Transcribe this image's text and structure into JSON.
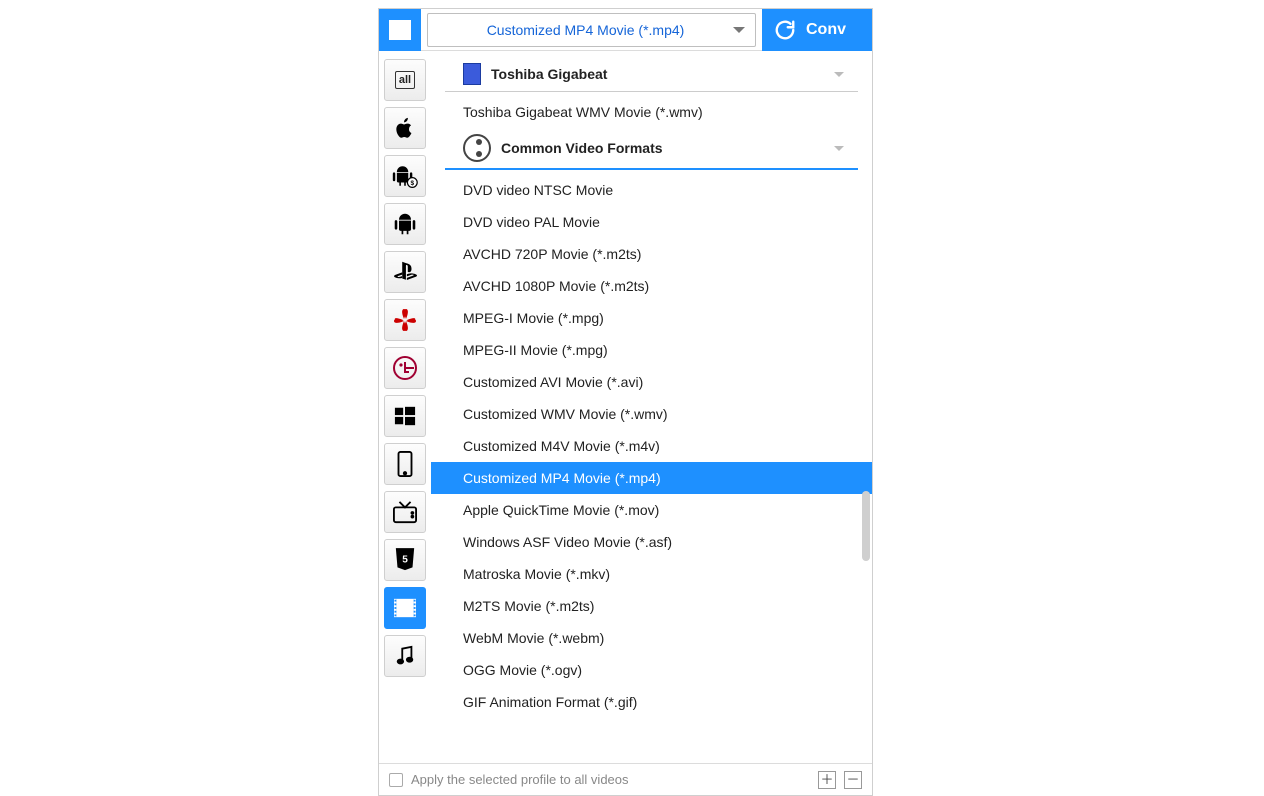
{
  "topbar": {
    "selected_format": "Customized MP4 Movie (*.mp4)",
    "convert_label": "Conv"
  },
  "sidebar": {
    "items": [
      {
        "name": "all",
        "label": "All"
      },
      {
        "name": "apple",
        "label": "Apple"
      },
      {
        "name": "android-paid",
        "label": "Android Paid"
      },
      {
        "name": "android",
        "label": "Android"
      },
      {
        "name": "playstation",
        "label": "PlayStation"
      },
      {
        "name": "huawei",
        "label": "Huawei"
      },
      {
        "name": "lg",
        "label": "LG"
      },
      {
        "name": "windows",
        "label": "Windows"
      },
      {
        "name": "phone",
        "label": "Phone"
      },
      {
        "name": "tv",
        "label": "TV"
      },
      {
        "name": "html5",
        "label": "HTML5"
      },
      {
        "name": "video",
        "label": "Video",
        "active": true
      },
      {
        "name": "audio",
        "label": "Audio"
      }
    ]
  },
  "groups": [
    {
      "title": "Toshiba Gigabeat",
      "icon": "toshiba",
      "items": [
        "Toshiba Gigabeat WMV Movie (*.wmv)"
      ]
    },
    {
      "title": "Common Video Formats",
      "icon": "reel",
      "items": [
        "DVD video NTSC Movie",
        "DVD video PAL Movie",
        "AVCHD 720P Movie (*.m2ts)",
        "AVCHD 1080P Movie (*.m2ts)",
        "MPEG-I Movie (*.mpg)",
        "MPEG-II Movie (*.mpg)",
        "Customized AVI Movie (*.avi)",
        "Customized WMV Movie (*.wmv)",
        "Customized M4V Movie (*.m4v)",
        "Customized MP4 Movie (*.mp4)",
        "Apple QuickTime Movie (*.mov)",
        "Windows ASF Video Movie (*.asf)",
        "Matroska Movie (*.mkv)",
        "M2TS Movie (*.m2ts)",
        "WebM Movie (*.webm)",
        "OGG Movie (*.ogv)",
        "GIF Animation Format (*.gif)"
      ],
      "selected_index": 9
    }
  ],
  "footer": {
    "apply_label": "Apply the selected profile to all videos"
  }
}
